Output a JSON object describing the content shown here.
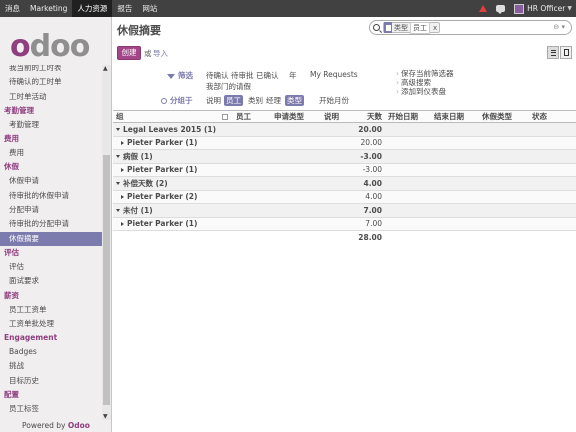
{
  "topbar": {
    "menu": [
      "消息",
      "Marketing",
      "人力资源",
      "报告",
      "网站"
    ],
    "active_index": 2,
    "user": "HR Officer"
  },
  "sidebar": {
    "logo_first": "o",
    "logo_rest": "doo",
    "powered_prefix": "Powered by",
    "powered_brand": "Odoo",
    "sections": [
      {
        "title": "",
        "items": [
          "我当前的工时表",
          "待确认的工时单",
          "工时单活动"
        ]
      },
      {
        "title": "考勤管理",
        "items": [
          "考勤管理"
        ]
      },
      {
        "title": "费用",
        "items": [
          "费用"
        ]
      },
      {
        "title": "休假",
        "items": [
          "休假申请",
          "待审批的休假申请",
          "分配申请",
          "待审批的分配申请",
          "休假摘要"
        ]
      },
      {
        "title": "评估",
        "items": [
          "评估",
          "面试要求"
        ]
      },
      {
        "title": "薪资",
        "items": [
          "员工工资单",
          "工资单批处理"
        ]
      },
      {
        "title": "Engagement",
        "items": [
          "Badges",
          "挑战",
          "目标历史"
        ]
      },
      {
        "title": "配置",
        "items": [
          "员工标签"
        ]
      }
    ],
    "active_item": "休假摘要"
  },
  "header": {
    "title": "休假摘要",
    "create": "创建",
    "or": "或",
    "import": "导入"
  },
  "search": {
    "facet_label": "类型",
    "facet_value": "员工",
    "facet_remove": "x"
  },
  "filters": {
    "filter_title": "筛选",
    "filter_row1": [
      "待确认",
      "待审批",
      "已确认",
      "年",
      "My Requests"
    ],
    "filter_row2": [
      "我部门的请假"
    ],
    "group_title": "分组于",
    "group_opts": [
      "说明",
      "员工",
      "类别",
      "经理",
      "类型",
      "开始月份"
    ],
    "group_selected": [
      "员工",
      "类型"
    ],
    "right": [
      "保存当前筛选器",
      "高级搜索",
      "添加到仪表盘"
    ]
  },
  "table": {
    "columns": [
      "组",
      "",
      "员工",
      "申请类型",
      "说明",
      "天数",
      "开始日期",
      "结束日期",
      "休假类型",
      "状态"
    ],
    "rows": [
      {
        "kind": "group",
        "name": "Legal Leaves 2015 (1)",
        "days": "20.00"
      },
      {
        "kind": "sub",
        "name": "Pieter Parker (1)",
        "days": "20.00"
      },
      {
        "kind": "group",
        "name": "病假 (1)",
        "days": "-3.00"
      },
      {
        "kind": "sub",
        "name": "Pieter Parker (1)",
        "days": "-3.00"
      },
      {
        "kind": "group",
        "name": "补偿天数 (2)",
        "days": "4.00"
      },
      {
        "kind": "sub",
        "name": "Pieter Parker (2)",
        "days": "4.00"
      },
      {
        "kind": "group",
        "name": "未付 (1)",
        "days": "7.00"
      },
      {
        "kind": "sub",
        "name": "Pieter Parker (1)",
        "days": "7.00"
      }
    ],
    "total": "28.00"
  },
  "colors": {
    "brand": "#8f3f80",
    "accent": "#7c7bad",
    "topbar": "#414141",
    "create_button": "#a24689",
    "alert": "#e04040"
  },
  "icons": [
    "alert-icon",
    "chat-icon",
    "avatar",
    "search-icon",
    "category-icon",
    "filter-icon",
    "group-icon",
    "list-view-icon",
    "form-view-icon",
    "caret-down-icon",
    "caret-right-icon"
  ]
}
